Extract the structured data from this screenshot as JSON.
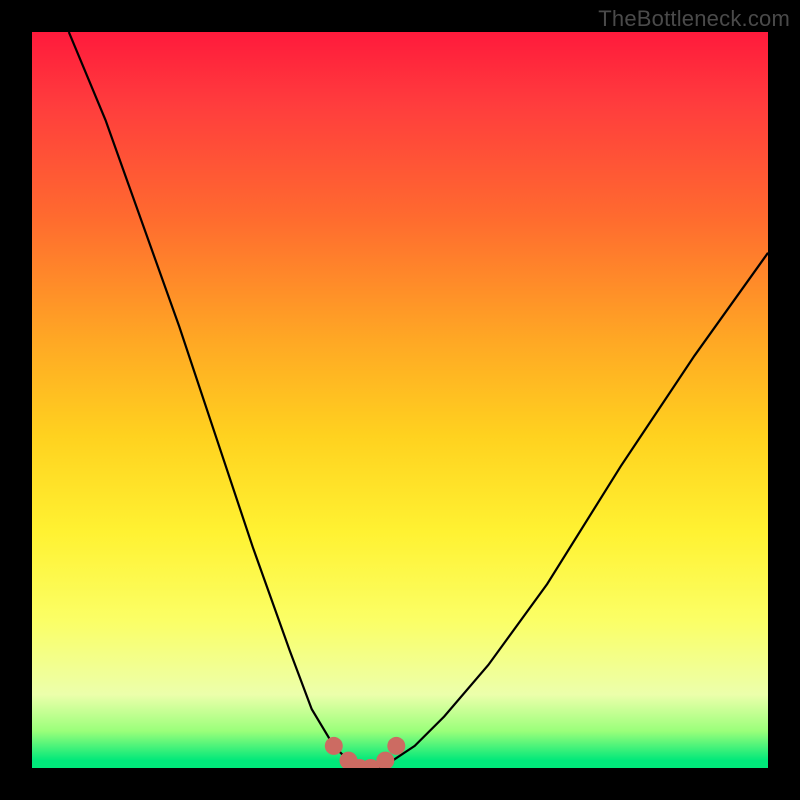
{
  "watermark": {
    "text": "TheBottleneck.com"
  },
  "colors": {
    "frame": "#000000",
    "curve": "#000000",
    "markers": "#cc6b62",
    "gradient_top": "#ff1a3c",
    "gradient_bottom": "#00e87a"
  },
  "chart_data": {
    "type": "line",
    "title": "",
    "xlabel": "",
    "ylabel": "",
    "xlim": [
      0,
      100
    ],
    "ylim": [
      0,
      100
    ],
    "grid": false,
    "legend": false,
    "note": "V-shaped bottleneck curve over vertical red-to-green gradient. y=0 (green) is optimal balance; higher y (red) is worse mismatch. x axis is hardware pairing ratio (unlabeled). Curve minimum sits near x≈45. Six salmon markers cluster at the trough.",
    "series": [
      {
        "name": "bottleneck-curve",
        "x": [
          5,
          10,
          15,
          20,
          25,
          30,
          35,
          38,
          41,
          43,
          45,
          47,
          49,
          52,
          56,
          62,
          70,
          80,
          90,
          100
        ],
        "y": [
          100,
          88,
          74,
          60,
          45,
          30,
          16,
          8,
          3,
          1,
          0,
          0,
          1,
          3,
          7,
          14,
          25,
          41,
          56,
          70
        ]
      }
    ],
    "markers": {
      "name": "trough-points",
      "x": [
        41,
        43,
        44.5,
        46,
        48,
        49.5
      ],
      "y": [
        3,
        1,
        0,
        0,
        1,
        3
      ]
    }
  }
}
